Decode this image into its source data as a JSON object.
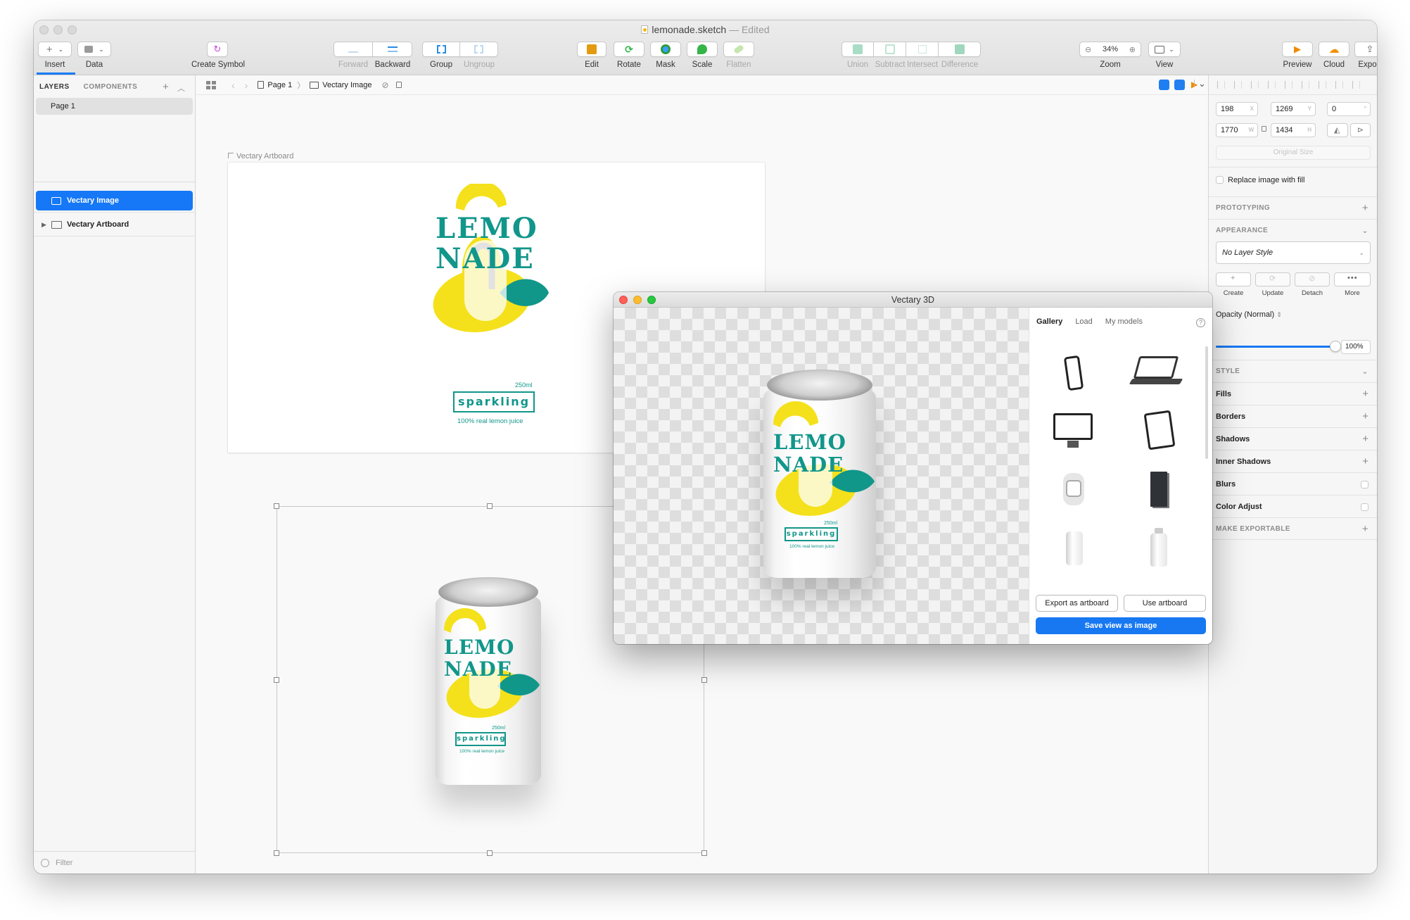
{
  "window": {
    "title": "lemonade.sketch",
    "title_suffix": "— Edited"
  },
  "toolbar": {
    "insert": "Insert",
    "data": "Data",
    "create_symbol": "Create Symbol",
    "forward": "Forward",
    "backward": "Backward",
    "group": "Group",
    "ungroup": "Ungroup",
    "edit": "Edit",
    "rotate": "Rotate",
    "mask": "Mask",
    "scale": "Scale",
    "flatten": "Flatten",
    "union": "Union",
    "subtract": "Subtract",
    "intersect": "Intersect",
    "difference": "Difference",
    "zoom_value": "34%",
    "zoom": "Zoom",
    "view": "View",
    "preview": "Preview",
    "cloud": "Cloud",
    "export": "Export"
  },
  "left_panel": {
    "tab_layers": "LAYERS",
    "tab_components": "COMPONENTS",
    "pages": [
      "Page 1"
    ],
    "layers": [
      {
        "label": "Vectary Image",
        "selected": true
      },
      {
        "label": "Vectary Artboard",
        "selected": false
      }
    ],
    "filter_placeholder": "Filter"
  },
  "breadcrumb": {
    "page": "Page 1",
    "layer": "Vectary Image"
  },
  "canvas": {
    "artboard_label": "Vectary Artboard",
    "label_art": {
      "line1": "LEMO",
      "line2": "NADE",
      "volume": "250ml",
      "badge": "sparkling",
      "tagline": "100% real lemon juice"
    }
  },
  "inspector": {
    "x": "198",
    "x_label": "X",
    "y": "1269",
    "y_label": "Y",
    "rotation": "0",
    "rotation_unit": "°",
    "w": "1770",
    "w_label": "W",
    "h": "1434",
    "h_label": "H",
    "original_size": "Original Size",
    "replace_fill": "Replace image with fill",
    "prototyping": "PROTOTYPING",
    "appearance": "APPEARANCE",
    "layer_style": "No Layer Style",
    "style_actions": [
      "Create",
      "Update",
      "Detach",
      "More"
    ],
    "opacity_label": "Opacity (Normal)",
    "opacity_value": "100%",
    "opacity_fraction": 1.0,
    "style": "STYLE",
    "sections": [
      "Fills",
      "Borders",
      "Shadows",
      "Inner Shadows",
      "Blurs",
      "Color Adjust"
    ],
    "make_exportable": "MAKE EXPORTABLE"
  },
  "vectary": {
    "title": "Vectary 3D",
    "tabs": [
      "Gallery",
      "Load",
      "My models"
    ],
    "help": "?",
    "export_artboard": "Export as artboard",
    "use_artboard": "Use artboard",
    "save_view": "Save view as image",
    "thumbnails": [
      "phone-mockup",
      "laptop-mockup",
      "desktop-monitor-mockup",
      "tablet-mockup",
      "smartwatch-mockup",
      "book-mockup",
      "can-mockup",
      "bottle-mockup"
    ]
  },
  "colors": {
    "accent": "#1678f6",
    "teal": "#11968a",
    "lemon": "#f4e11c"
  }
}
